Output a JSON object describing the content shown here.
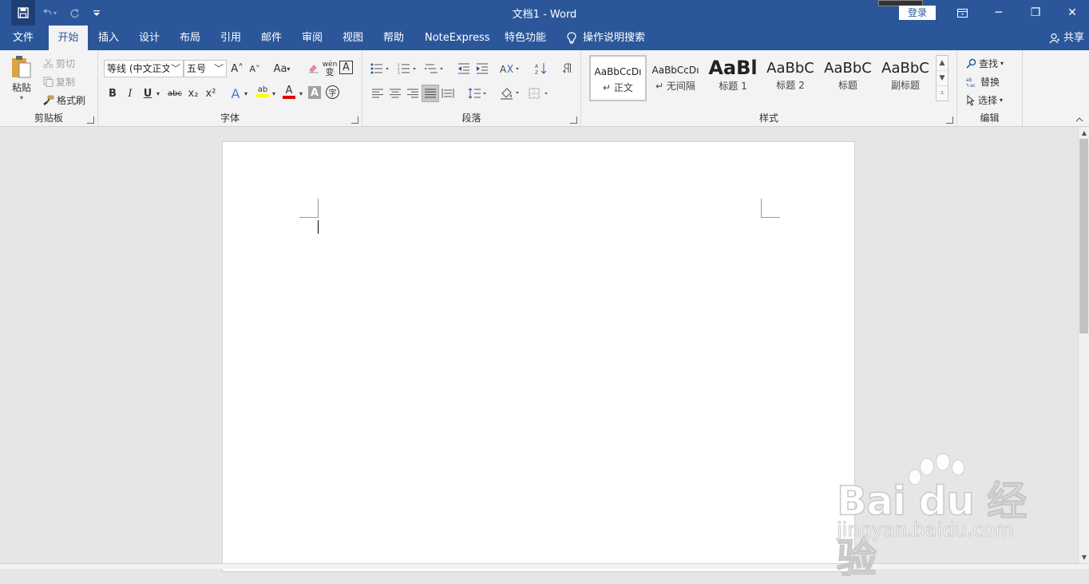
{
  "window": {
    "title": "文档1  -  Word",
    "sign_in": "登录",
    "buttons": {
      "minimize": "─",
      "restore": "❐",
      "close": "✕",
      "ribbon_display": "▭"
    }
  },
  "quick_access": {
    "save": "💾",
    "undo": "↶",
    "redo": "↻",
    "customize": "▾"
  },
  "tabs": [
    "文件",
    "开始",
    "插入",
    "设计",
    "布局",
    "引用",
    "邮件",
    "审阅",
    "视图",
    "帮助",
    "NoteExpress",
    "特色功能"
  ],
  "active_tab": "开始",
  "tell_me": "操作说明搜索",
  "share": "共享",
  "clipboard": {
    "label": "剪贴板",
    "paste": "粘贴",
    "cut": "剪切",
    "copy": "复制",
    "format_painter": "格式刷"
  },
  "font": {
    "label": "字体",
    "font_name": "等线 (中文正文",
    "font_size": "五号",
    "grow": "A˄",
    "shrink": "A˅",
    "change_case": "Aa",
    "bold": "B",
    "italic": "I",
    "underline": "U",
    "strike": "abc",
    "subscript": "x₂",
    "superscript": "x²",
    "phonetic": "wén",
    "char_border": "A",
    "text_effects": "A",
    "highlight": "ab",
    "font_color": "A",
    "char_shading": "A",
    "enclose": "字",
    "highlight_color": "#ffff00",
    "font_color_value": "#e00000"
  },
  "paragraph": {
    "label": "段落"
  },
  "styles": {
    "label": "样式",
    "items": [
      {
        "sample": "AaBbCcDı",
        "name": "正文"
      },
      {
        "sample": "AaBbCcDı",
        "name": "无间隔"
      },
      {
        "sample": "AaBl",
        "name": "标题 1"
      },
      {
        "sample": "AaBbC",
        "name": "标题 2"
      },
      {
        "sample": "AaBbC",
        "name": "标题"
      },
      {
        "sample": "AaBbC",
        "name": "副标题"
      }
    ]
  },
  "editing": {
    "label": "编辑",
    "find": "查找",
    "replace": "替换",
    "select": "选择"
  },
  "watermark": {
    "logo": "Bai du 经验",
    "url": "jingyan.baidu.com"
  },
  "colors": {
    "brand": "#2b579a"
  }
}
